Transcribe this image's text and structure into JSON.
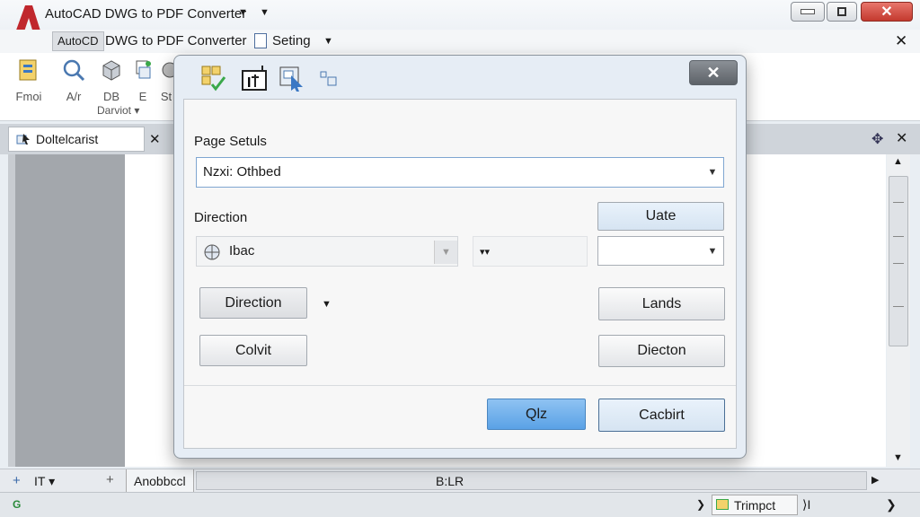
{
  "window": {
    "title": "AutoCAD DWG to PDF Converter"
  },
  "tabs": {
    "active": "AutoCD",
    "app": "DWG to PDF Converter",
    "setting": "Seting"
  },
  "ribbon": {
    "items": [
      {
        "label": "Fmoi",
        "icon": "import-icon"
      },
      {
        "label": "A/r",
        "icon": "search-icon"
      },
      {
        "label": "DB",
        "icon": "cube-icon"
      },
      {
        "label": "E",
        "icon": "drawing-icon"
      },
      {
        "label": "St",
        "icon": "settings-icon"
      }
    ],
    "group_label": "Darviot"
  },
  "document_tab": {
    "label": "Doltelcarist"
  },
  "dialog": {
    "page_setup_label": "Page Setuls",
    "page_setup_value": "Nzxi: Othbed",
    "direction_label": "Direction",
    "uate_button": "Uate",
    "icon_combo_value": "Ibac",
    "small_combo_value": "▾▾",
    "direction_button": "Direction",
    "lands_button": "Lands",
    "colvit_button": "Colvit",
    "diecton_button": "Diecton",
    "ok_button": "Qlz",
    "cancel_button": "Cacbirt"
  },
  "bottom": {
    "left_label": "IT",
    "panel_label": "Anobbccl",
    "center_label": "B:LR",
    "status_left": "G",
    "status_item": "Trimpct",
    "status_nav": "⟩I"
  },
  "colors": {
    "accent": "#5aa2e6",
    "logo": "#c0272d"
  }
}
